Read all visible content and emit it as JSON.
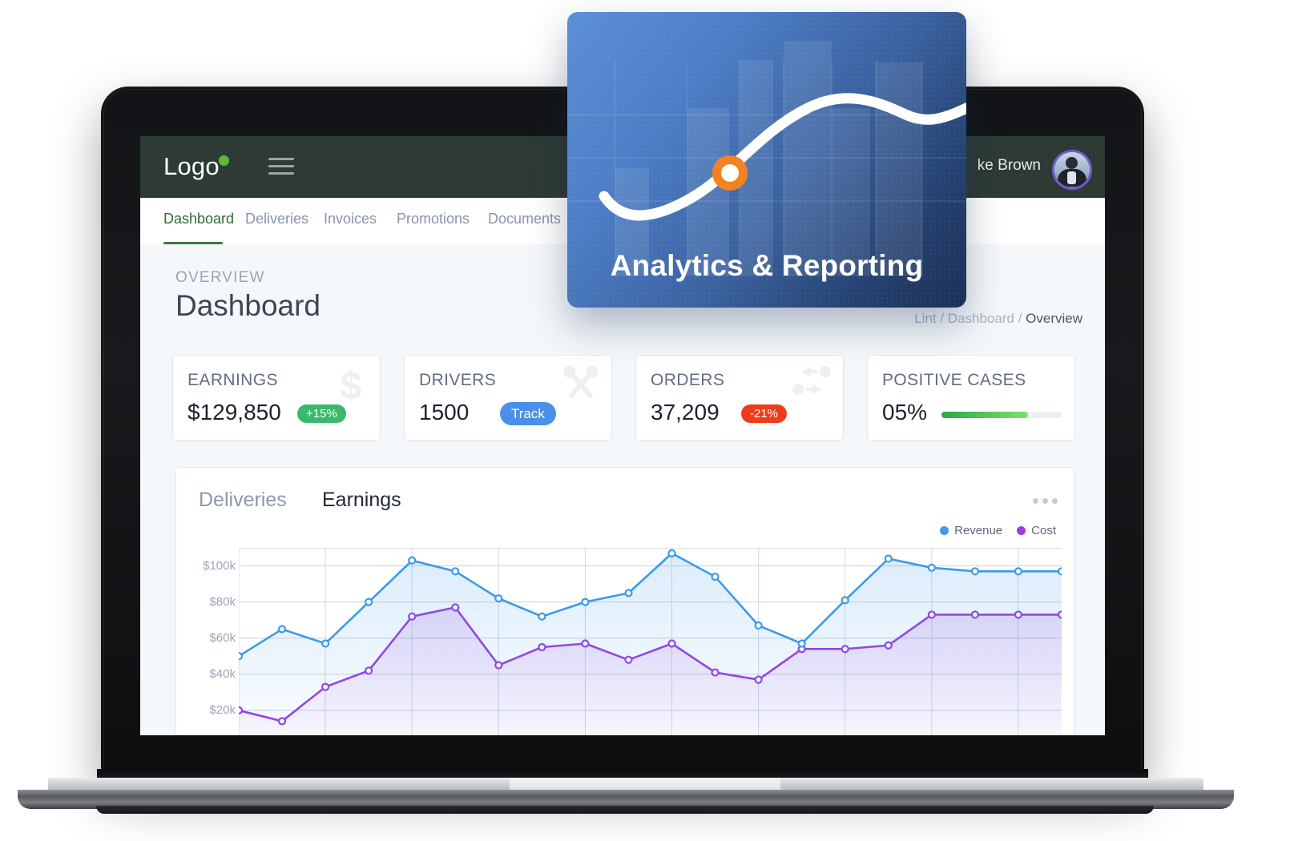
{
  "header": {
    "logo_text": "Logo",
    "logo_dot_color": "#5eb73b",
    "menu_icon": "hamburger-menu-icon",
    "user_name": "ke Brown",
    "avatar_icon": "user-avatar",
    "background_color": "#2d3a34"
  },
  "nav": {
    "tabs": [
      {
        "label": "Dashboard",
        "active": true
      },
      {
        "label": "Deliveries",
        "active": false
      },
      {
        "label": "Invoices",
        "active": false
      },
      {
        "label": "Promotions",
        "active": false
      },
      {
        "label": "Documents",
        "active": false
      }
    ],
    "active_color": "#2d6b35"
  },
  "page": {
    "eyebrow": "OVERVIEW",
    "title": "Dashboard",
    "breadcrumb_prefix": "Lint / Dashboard / ",
    "breadcrumb_current": "Overview"
  },
  "stats": [
    {
      "label": "EARNINGS",
      "value": "$129,850",
      "badge": "+15%",
      "badge_kind": "green",
      "badge_color": "#3ab96b",
      "icon": "dollar-sign-icon"
    },
    {
      "label": "DRIVERS",
      "value": "1500",
      "badge": "Track",
      "badge_kind": "blue",
      "badge_color": "#4a90e8",
      "icon": "wrench-screwdriver-icon"
    },
    {
      "label": "ORDERS",
      "value": "37,209",
      "badge": "-21%",
      "badge_kind": "red",
      "badge_color": "#ef3b19",
      "icon": "transfer-arrows-icon"
    },
    {
      "label": "POSITIVE CASES",
      "value": "05%",
      "badge": "",
      "badge_kind": "progress",
      "progress_percent": 72,
      "progress_color": "#3fbf57",
      "icon": "progress-bar-icon"
    }
  ],
  "chart_panel": {
    "tabs": [
      {
        "label": "Deliveries",
        "selected": false
      },
      {
        "label": "Earnings",
        "selected": true
      }
    ],
    "menu_icon": "kebab-menu-icon"
  },
  "chart_data": {
    "type": "line",
    "title": "Earnings",
    "xlabel": "",
    "ylabel": "",
    "ylim": [
      0,
      110
    ],
    "ytick_labels": [
      "$100k",
      "$80k",
      "$60k",
      "$40k",
      "$20k"
    ],
    "ytick_values": [
      100,
      80,
      60,
      40,
      20
    ],
    "grid": true,
    "legend_position": "top-right",
    "x": [
      1,
      2,
      3,
      4,
      5,
      6,
      7,
      8,
      9,
      10,
      11,
      12,
      13,
      14,
      15,
      16,
      17,
      18,
      19,
      20
    ],
    "series": [
      {
        "name": "Revenue",
        "color": "#3d9ae8",
        "values": [
          50,
          65,
          57,
          80,
          103,
          97,
          82,
          72,
          80,
          85,
          107,
          94,
          67,
          57,
          81,
          104,
          99,
          97,
          97,
          97
        ]
      },
      {
        "name": "Cost",
        "color": "#9b3fe0",
        "values": [
          20,
          14,
          33,
          42,
          72,
          77,
          45,
          55,
          57,
          48,
          57,
          41,
          37,
          54,
          54,
          56,
          73,
          73,
          73,
          73
        ]
      }
    ]
  },
  "overlay": {
    "title": "Analytics & Reporting",
    "marker_icon": "chart-point-marker",
    "marker_color": "#f58220",
    "gradient_from": "#5b8fd6",
    "gradient_to": "#1c3058"
  }
}
